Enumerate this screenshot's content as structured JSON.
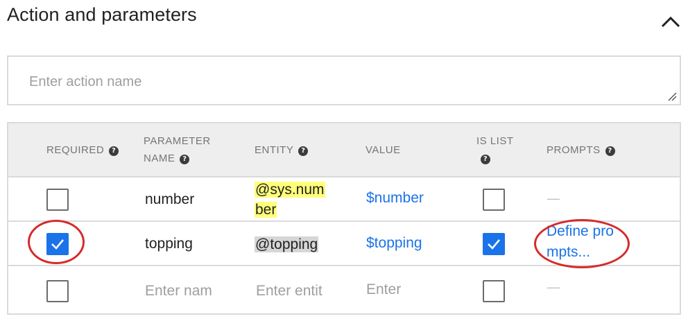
{
  "section": {
    "title": "Action and parameters",
    "collapse_icon": "chevron-up-icon"
  },
  "action": {
    "placeholder": "Enter action name",
    "value": ""
  },
  "table": {
    "headers": {
      "required": "REQUIRED",
      "parameter_name_line1": "PARAMETER",
      "parameter_name_line2": "NAME",
      "entity": "ENTITY",
      "value": "VALUE",
      "is_list": "IS LIST",
      "prompts": "PROMPTS"
    },
    "help_icon_glyph": "?",
    "rows": [
      {
        "required": false,
        "name": "number",
        "entity": "@sys.number",
        "entity_line1": "@sys.num",
        "entity_line2": "ber",
        "value": "$number",
        "is_list": false,
        "prompts": "—"
      },
      {
        "required": true,
        "name": "topping",
        "entity": "@topping",
        "value": "$topping",
        "is_list": true,
        "prompts": "Define prompts...",
        "prompts_line1": "Define pro",
        "prompts_line2": "mpts..."
      },
      {
        "required": false,
        "name_placeholder": "Enter nam",
        "entity_placeholder": "Enter entit",
        "value_placeholder": "Enter",
        "is_list": false,
        "prompts": "—"
      }
    ]
  },
  "colors": {
    "accent": "#1a73e8",
    "annotation": "#d62a2a",
    "entity_sys_highlight": "#ffff7a",
    "entity_custom_highlight": "#d6d6d6"
  }
}
